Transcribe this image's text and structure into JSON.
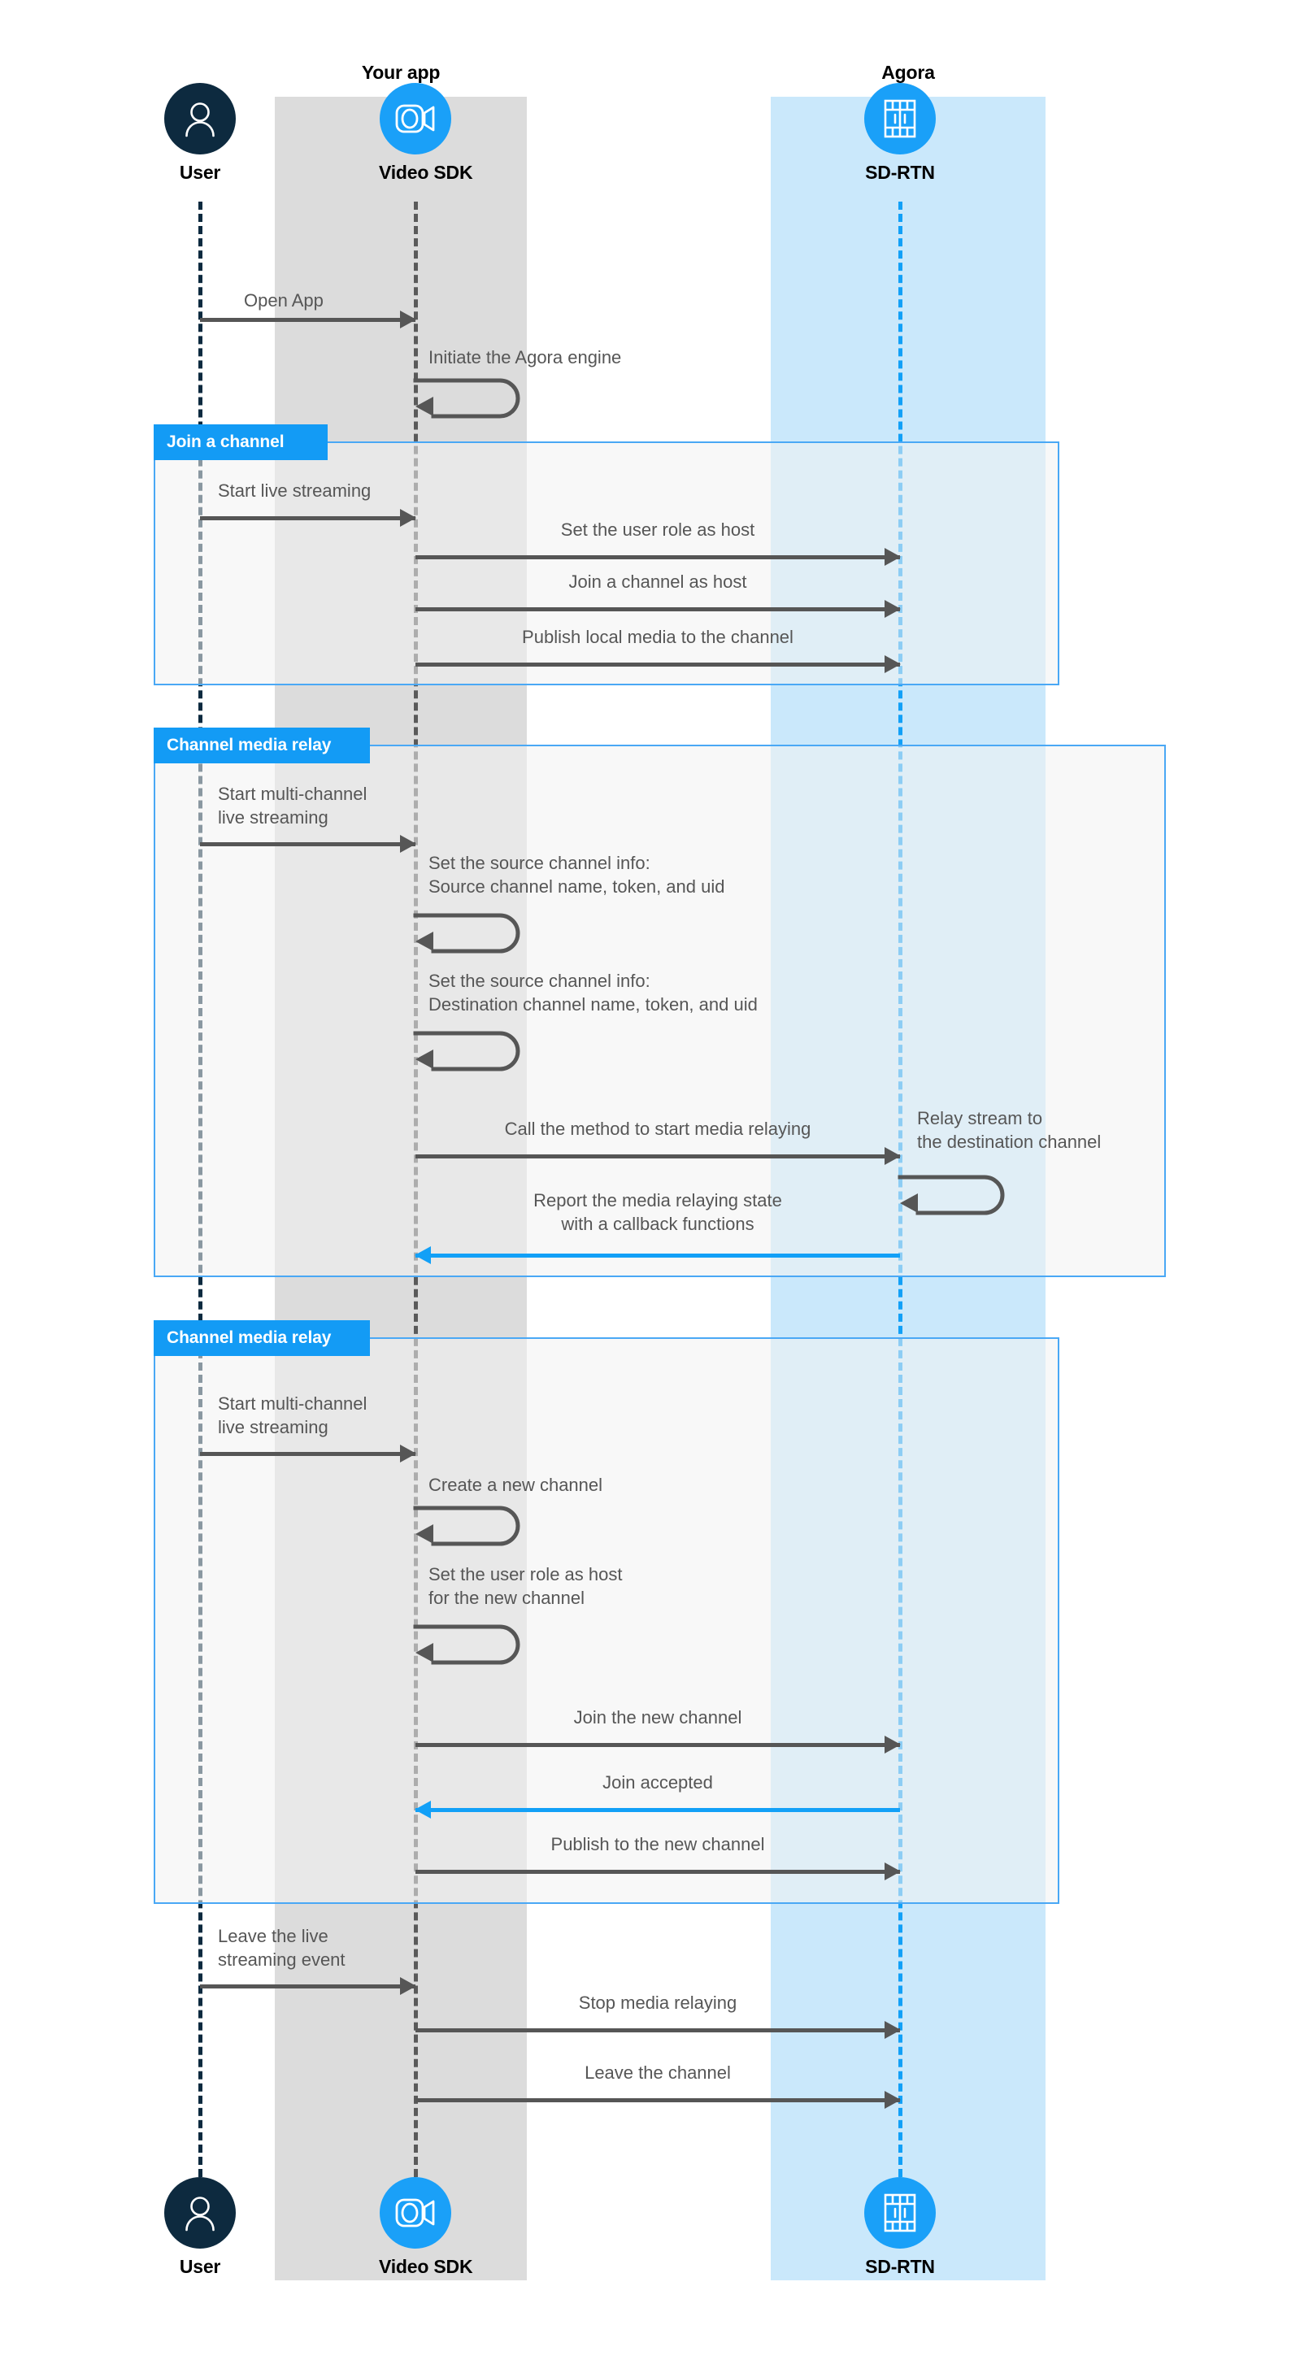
{
  "diagram": {
    "title": "Agora channel media relay sequence diagram",
    "colors": {
      "accent_blue": "#139bf5",
      "lifeline_blue": "#12a0f7",
      "actor_dark": "#0d2a3f",
      "band_app": "#dcdcdc",
      "band_agora": "#cae8fb",
      "message_text": "#565656",
      "arrow_grey": "#565656",
      "frame_border": "#4aa8f5"
    }
  },
  "groups": [
    {
      "id": "your-app",
      "label": "Your app"
    },
    {
      "id": "agora",
      "label": "Agora"
    }
  ],
  "actors": [
    {
      "id": "user",
      "label": "User",
      "icon": "person-icon"
    },
    {
      "id": "video-sdk",
      "label": "Video SDK",
      "icon": "video-camera-icon"
    },
    {
      "id": "sd-rtn",
      "label": "SD-RTN",
      "icon": "network-grid-icon"
    }
  ],
  "actors_bottom": [
    {
      "id": "user",
      "label": "User",
      "icon": "person-icon"
    },
    {
      "id": "video-sdk",
      "label": "Video SDK",
      "icon": "video-camera-icon"
    },
    {
      "id": "sd-rtn",
      "label": "SD-RTN",
      "icon": "network-grid-icon"
    }
  ],
  "fragments": [
    {
      "id": "join-a-channel",
      "label": "Join a channel"
    },
    {
      "id": "channel-media-relay-1",
      "label": "Channel media relay"
    },
    {
      "id": "channel-media-relay-2",
      "label": "Channel media relay"
    }
  ],
  "messages": [
    {
      "id": "m1",
      "text": "Open App",
      "from": "user",
      "to": "video-sdk",
      "kind": "arrow",
      "direction": "right",
      "color": "grey"
    },
    {
      "id": "m2",
      "text": "Initiate the Agora engine",
      "from": "video-sdk",
      "to": "video-sdk",
      "kind": "selfloop",
      "direction": "left",
      "color": "grey"
    },
    {
      "id": "m3",
      "text": "Start live streaming",
      "from": "user",
      "to": "video-sdk",
      "kind": "arrow",
      "direction": "right",
      "color": "grey"
    },
    {
      "id": "m4",
      "text": "Set the user role as host",
      "from": "video-sdk",
      "to": "sd-rtn",
      "kind": "arrow",
      "direction": "right",
      "color": "grey"
    },
    {
      "id": "m5",
      "text": "Join a channel as host",
      "from": "video-sdk",
      "to": "sd-rtn",
      "kind": "arrow",
      "direction": "right",
      "color": "grey"
    },
    {
      "id": "m6",
      "text": "Publish local media to the channel",
      "from": "video-sdk",
      "to": "sd-rtn",
      "kind": "arrow",
      "direction": "right",
      "color": "grey"
    },
    {
      "id": "m7",
      "text": "Start multi-channel\nlive streaming",
      "from": "user",
      "to": "video-sdk",
      "kind": "arrow",
      "direction": "right",
      "color": "grey"
    },
    {
      "id": "m8",
      "text": "Set the source channel info:\nSource channel name, token, and uid",
      "from": "video-sdk",
      "to": "video-sdk",
      "kind": "selfloop",
      "direction": "left",
      "color": "grey"
    },
    {
      "id": "m9",
      "text": "Set the source channel info:\nDestination channel name, token, and uid",
      "from": "video-sdk",
      "to": "video-sdk",
      "kind": "selfloop",
      "direction": "left",
      "color": "grey"
    },
    {
      "id": "m10",
      "text": "Call the method to start media relaying",
      "from": "video-sdk",
      "to": "sd-rtn",
      "kind": "arrow",
      "direction": "right",
      "color": "grey"
    },
    {
      "id": "m11",
      "text": "Relay stream to\nthe destination channel",
      "from": "sd-rtn",
      "to": "sd-rtn",
      "kind": "selfloop",
      "direction": "left",
      "color": "grey"
    },
    {
      "id": "m12",
      "text": "Report the media relaying state\nwith a callback functions",
      "from": "sd-rtn",
      "to": "video-sdk",
      "kind": "arrow",
      "direction": "left",
      "color": "blue"
    },
    {
      "id": "m13",
      "text": "Start multi-channel\nlive streaming",
      "from": "user",
      "to": "video-sdk",
      "kind": "arrow",
      "direction": "right",
      "color": "grey"
    },
    {
      "id": "m14",
      "text": "Create a new channel",
      "from": "video-sdk",
      "to": "video-sdk",
      "kind": "selfloop",
      "direction": "left",
      "color": "grey"
    },
    {
      "id": "m15",
      "text": "Set the user role as host\nfor the new channel",
      "from": "video-sdk",
      "to": "video-sdk",
      "kind": "selfloop",
      "direction": "left",
      "color": "grey"
    },
    {
      "id": "m16",
      "text": "Join the new channel",
      "from": "video-sdk",
      "to": "sd-rtn",
      "kind": "arrow",
      "direction": "right",
      "color": "grey"
    },
    {
      "id": "m17",
      "text": "Join accepted",
      "from": "sd-rtn",
      "to": "video-sdk",
      "kind": "arrow",
      "direction": "left",
      "color": "blue"
    },
    {
      "id": "m18",
      "text": "Publish to the new channel",
      "from": "video-sdk",
      "to": "sd-rtn",
      "kind": "arrow",
      "direction": "right",
      "color": "grey"
    },
    {
      "id": "m19",
      "text": "Leave the live\nstreaming event",
      "from": "user",
      "to": "video-sdk",
      "kind": "arrow",
      "direction": "right",
      "color": "grey"
    },
    {
      "id": "m20",
      "text": "Stop media relaying",
      "from": "video-sdk",
      "to": "sd-rtn",
      "kind": "arrow",
      "direction": "right",
      "color": "grey"
    },
    {
      "id": "m21",
      "text": "Leave the channel",
      "from": "video-sdk",
      "to": "sd-rtn",
      "kind": "arrow",
      "direction": "right",
      "color": "grey"
    }
  ]
}
